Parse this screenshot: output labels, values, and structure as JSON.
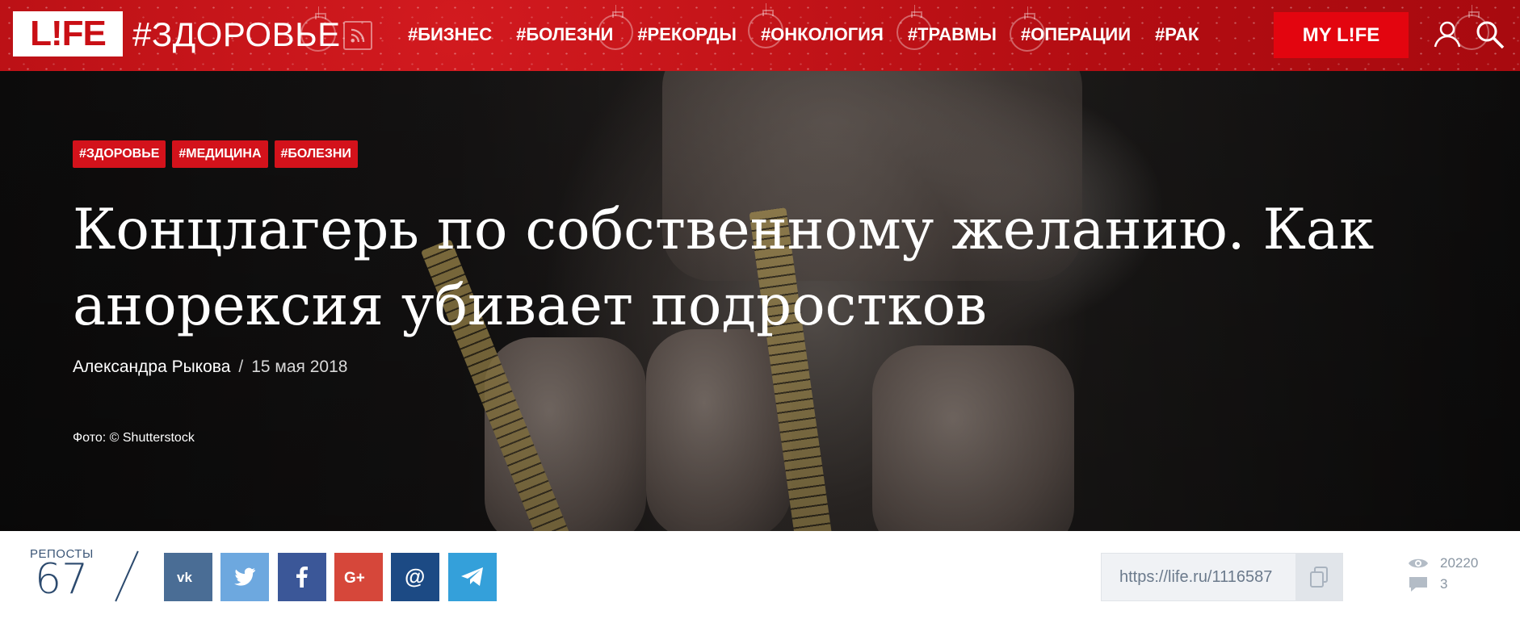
{
  "header": {
    "logo_text": "L!FE",
    "section_title": "#ЗДОРОВЬЕ",
    "nav": [
      "#БИЗНЕС",
      "#БОЛЕЗНИ",
      "#РЕКОРДЫ",
      "#ОНКОЛОГИЯ",
      "#ТРАВМЫ",
      "#ОПЕРАЦИИ",
      "#РАК"
    ],
    "my_life_label": "MY L!FE",
    "colors": {
      "brand_red": "#c90f15",
      "button_red": "#e3050f"
    },
    "icons": [
      "rss-icon",
      "user-icon",
      "search-icon"
    ]
  },
  "article": {
    "tags": [
      "#ЗДОРОВЬЕ",
      "#МЕДИЦИНА",
      "#БОЛЕЗНИ"
    ],
    "title": "Концлагерь по собственному желанию. Как анорексия убивает подростков",
    "author": "Александра Рыкова",
    "separator": "/",
    "date": "15 мая 2018",
    "photo_credit": "Фото: © Shutterstock"
  },
  "share": {
    "reposts_label": "РЕПОСТЫ",
    "reposts_count": "67",
    "networks": [
      "vk-icon",
      "twitter-icon",
      "facebook-icon",
      "google-plus-icon",
      "mail-icon",
      "telegram-icon"
    ],
    "url": "https://life.ru/1116587",
    "views": "20220",
    "comments": "3"
  }
}
